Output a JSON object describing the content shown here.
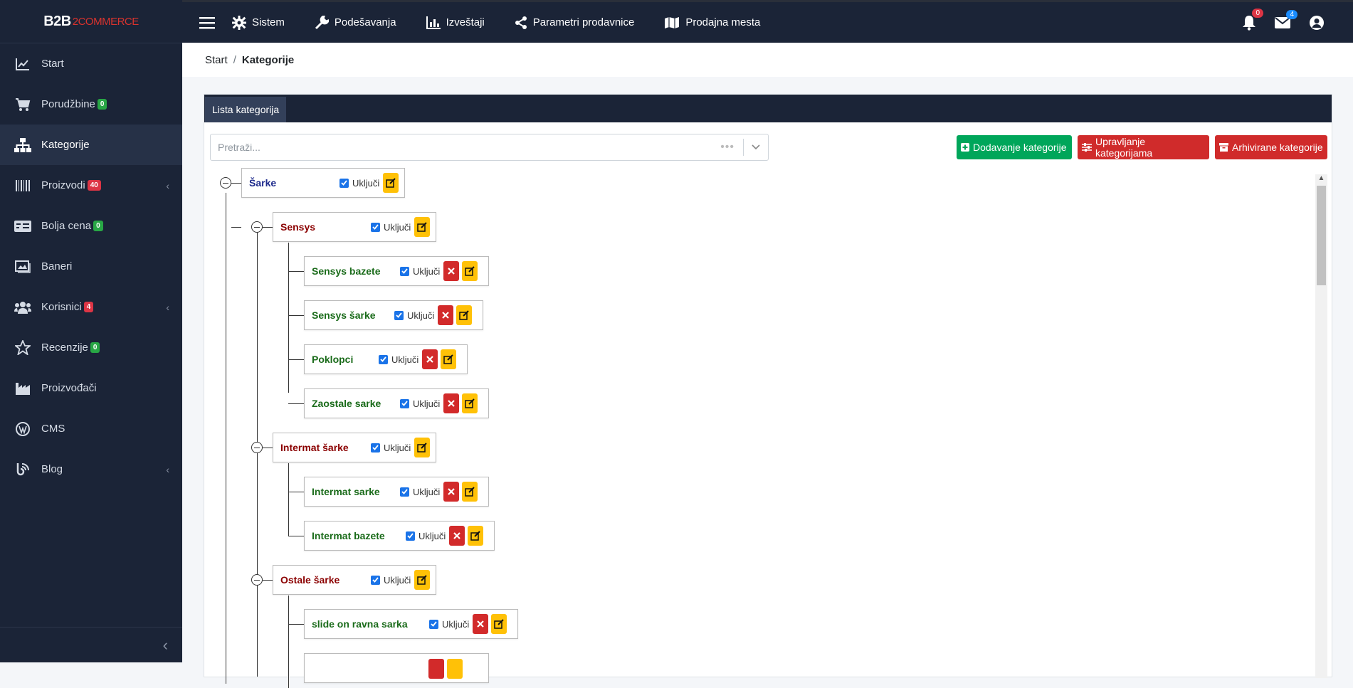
{
  "brand": {
    "part1": "B2B",
    "part2": "2COMMERCE"
  },
  "sidebar": {
    "items": [
      {
        "label": "Start",
        "icon": "chart-line-icon"
      },
      {
        "label": "Porudžbine",
        "icon": "cart-icon",
        "badge": "0",
        "badge_color": "green"
      },
      {
        "label": "Kategorije",
        "icon": "sitemap-icon",
        "active": true
      },
      {
        "label": "Proizvodi",
        "icon": "barcode-icon",
        "badge": "40",
        "badge_color": "red",
        "chevron": true
      },
      {
        "label": "Bolja cena",
        "icon": "money-check-icon",
        "badge": "0",
        "badge_color": "green"
      },
      {
        "label": "Baneri",
        "icon": "images-icon"
      },
      {
        "label": "Korisnici",
        "icon": "users-icon",
        "badge": "4",
        "badge_color": "red",
        "chevron": true
      },
      {
        "label": "Recenzije",
        "icon": "star-icon",
        "badge": "0",
        "badge_color": "green"
      },
      {
        "label": "Proizvođači",
        "icon": "industry-icon"
      },
      {
        "label": "CMS",
        "icon": "wordpress-icon"
      },
      {
        "label": "Blog",
        "icon": "blog-icon",
        "chevron": true
      }
    ]
  },
  "topnav": {
    "items": [
      {
        "label": "Sistem",
        "icon": "gear-icon"
      },
      {
        "label": "Podešavanja",
        "icon": "wrench-icon"
      },
      {
        "label": "Izveštaji",
        "icon": "bar-chart-icon"
      },
      {
        "label": "Parametri prodavnice",
        "icon": "share-icon"
      },
      {
        "label": "Prodajna mesta",
        "icon": "map-icon"
      }
    ],
    "notifications_count": "0",
    "messages_count": "4"
  },
  "breadcrumb": {
    "home": "Start",
    "separator": "/",
    "current": "Kategorije"
  },
  "card": {
    "tab_label": "Lista kategorija",
    "search_placeholder": "Pretraži...",
    "buttons": {
      "add": "Dodavanje kategorije",
      "manage": "Upravljanje kategorijama",
      "archived": "Arhivirane kategorije"
    }
  },
  "tree": {
    "toggle_label": "Uključi",
    "nodes": [
      {
        "name": "Šarke",
        "level": 0,
        "deletable": false
      },
      {
        "name": "Sensys",
        "level": 1,
        "deletable": false
      },
      {
        "name": "Sensys bazete",
        "level": 2,
        "deletable": true
      },
      {
        "name": "Sensys šarke",
        "level": 2,
        "deletable": true
      },
      {
        "name": "Poklopci",
        "level": 2,
        "deletable": true
      },
      {
        "name": "Zaostale sarke",
        "level": 2,
        "deletable": true
      },
      {
        "name": "Intermat šarke",
        "level": 1,
        "deletable": false
      },
      {
        "name": "Intermat sarke",
        "level": 2,
        "deletable": true
      },
      {
        "name": "Intermat bazete",
        "level": 2,
        "deletable": true
      },
      {
        "name": "Ostale šarke",
        "level": 1,
        "deletable": false
      },
      {
        "name": "slide on ravna sarka",
        "level": 2,
        "deletable": true
      }
    ]
  },
  "colors": {
    "sidebar_bg": "#1b2437",
    "accent_green": "#00a65a",
    "accent_red": "#d02b2b",
    "edit_yellow": "#ffc107"
  }
}
